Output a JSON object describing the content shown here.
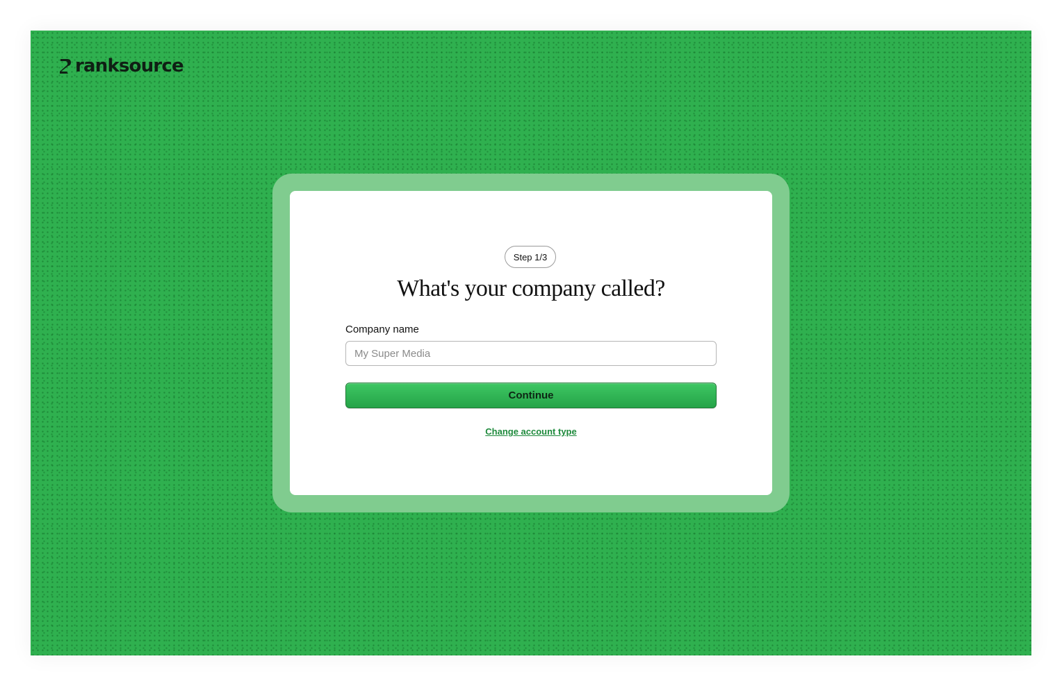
{
  "brand": {
    "name": "ranksource",
    "logo_icon": "ranksource-logo-icon",
    "background_color": "#2fb04f",
    "accent_color": "#80cc8f"
  },
  "onboarding": {
    "step_label": "Step 1/3",
    "heading": "What's your company called?",
    "company_field": {
      "label": "Company name",
      "placeholder": "My Super Media",
      "value": ""
    },
    "continue_label": "Continue",
    "change_account_label": "Change account type"
  }
}
